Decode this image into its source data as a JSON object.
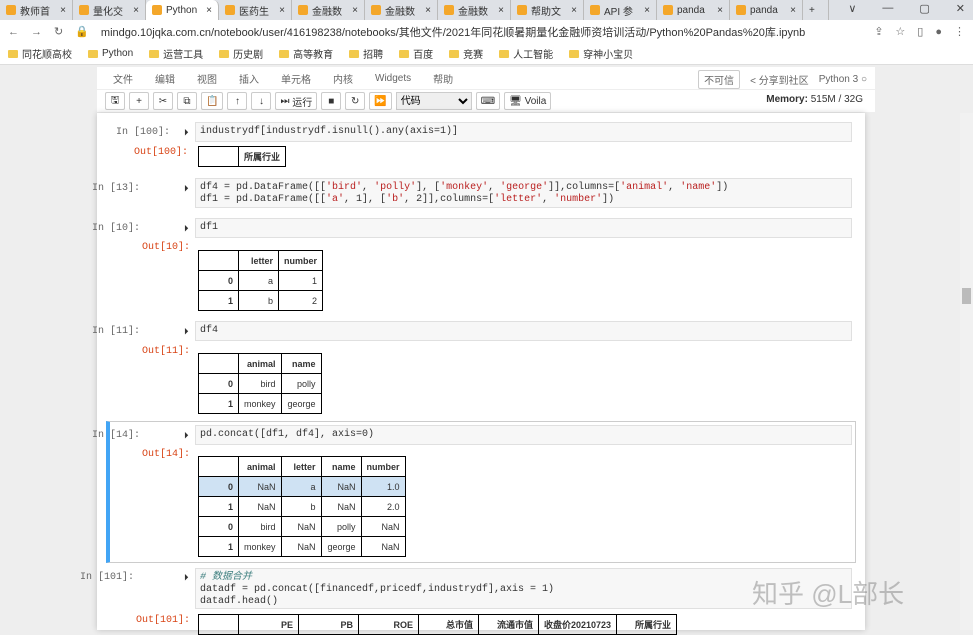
{
  "browser": {
    "tabs": [
      "教师首",
      "量化交",
      "Python",
      "医药生",
      "金融数",
      "金融数",
      "金融数",
      "帮助文",
      "API 参",
      "panda",
      "panda"
    ],
    "active_tab": 2,
    "new_tab": "+",
    "window_controls": [
      "∨",
      "—",
      "▢",
      "✕"
    ],
    "url": "mindgo.10jqka.com.cn/notebook/user/416198238/notebooks/其他文件/2021年同花顺暑期量化金融师资培训活动/Python%20Pandas%20库.ipynb",
    "bookmarks": [
      "同花顺高校",
      "Python",
      "运营工具",
      "历史剧",
      "高等教育",
      "招聘",
      "百度",
      "竞赛",
      "人工智能",
      "穿神小宝贝"
    ]
  },
  "menu": {
    "items": [
      "文件",
      "编辑",
      "视图",
      "插入",
      "单元格",
      "内核",
      "Widgets",
      "帮助"
    ],
    "trusted": "不可信",
    "share": "分享到社区",
    "kernel": "Python 3"
  },
  "toolbar": {
    "run": "运行",
    "cell_type": "代码",
    "voila": "Voila",
    "memory_label": "Memory:",
    "memory_value": "515M / 32G"
  },
  "cells": {
    "c100": {
      "in": "In  [100]:",
      "code": "industrydf[industrydf.isnull().any(axis=1)]",
      "out": "Out[100]:",
      "headers": [
        "",
        "所属行业"
      ]
    },
    "c13": {
      "in": "In  [13]:"
    },
    "c10": {
      "in": "In  [10]:",
      "code": "df1",
      "out": "Out[10]:",
      "headers": [
        "",
        "letter",
        "number"
      ],
      "rows": [
        [
          "0",
          "a",
          "1"
        ],
        [
          "1",
          "b",
          "2"
        ]
      ]
    },
    "c11": {
      "in": "In  [11]:",
      "code": "df4",
      "out": "Out[11]:",
      "headers": [
        "",
        "animal",
        "name"
      ],
      "rows": [
        [
          "0",
          "bird",
          "polly"
        ],
        [
          "1",
          "monkey",
          "george"
        ]
      ]
    },
    "c14": {
      "in": "In  [14]:",
      "code": "pd.concat([df1, df4], axis=0)",
      "out": "Out[14]:",
      "headers": [
        "",
        "animal",
        "letter",
        "name",
        "number"
      ],
      "rows": [
        [
          "0",
          "NaN",
          "a",
          "NaN",
          "1.0"
        ],
        [
          "1",
          "NaN",
          "b",
          "NaN",
          "2.0"
        ],
        [
          "0",
          "bird",
          "NaN",
          "polly",
          "NaN"
        ],
        [
          "1",
          "monkey",
          "NaN",
          "george",
          "NaN"
        ]
      ]
    },
    "c101": {
      "in": "In  [101]:",
      "comment": "# 数据合并",
      "line2": "datadf = pd.concat([financedf,pricedf,industrydf],axis = 1)",
      "line3": "datadf.head()",
      "out": "Out[101]:",
      "headers": [
        "",
        "PE",
        "PB",
        "ROE",
        "总市值",
        "流通市值",
        "收盘价20210723",
        "所属行业"
      ]
    }
  },
  "watermark": "知乎 @L部长"
}
